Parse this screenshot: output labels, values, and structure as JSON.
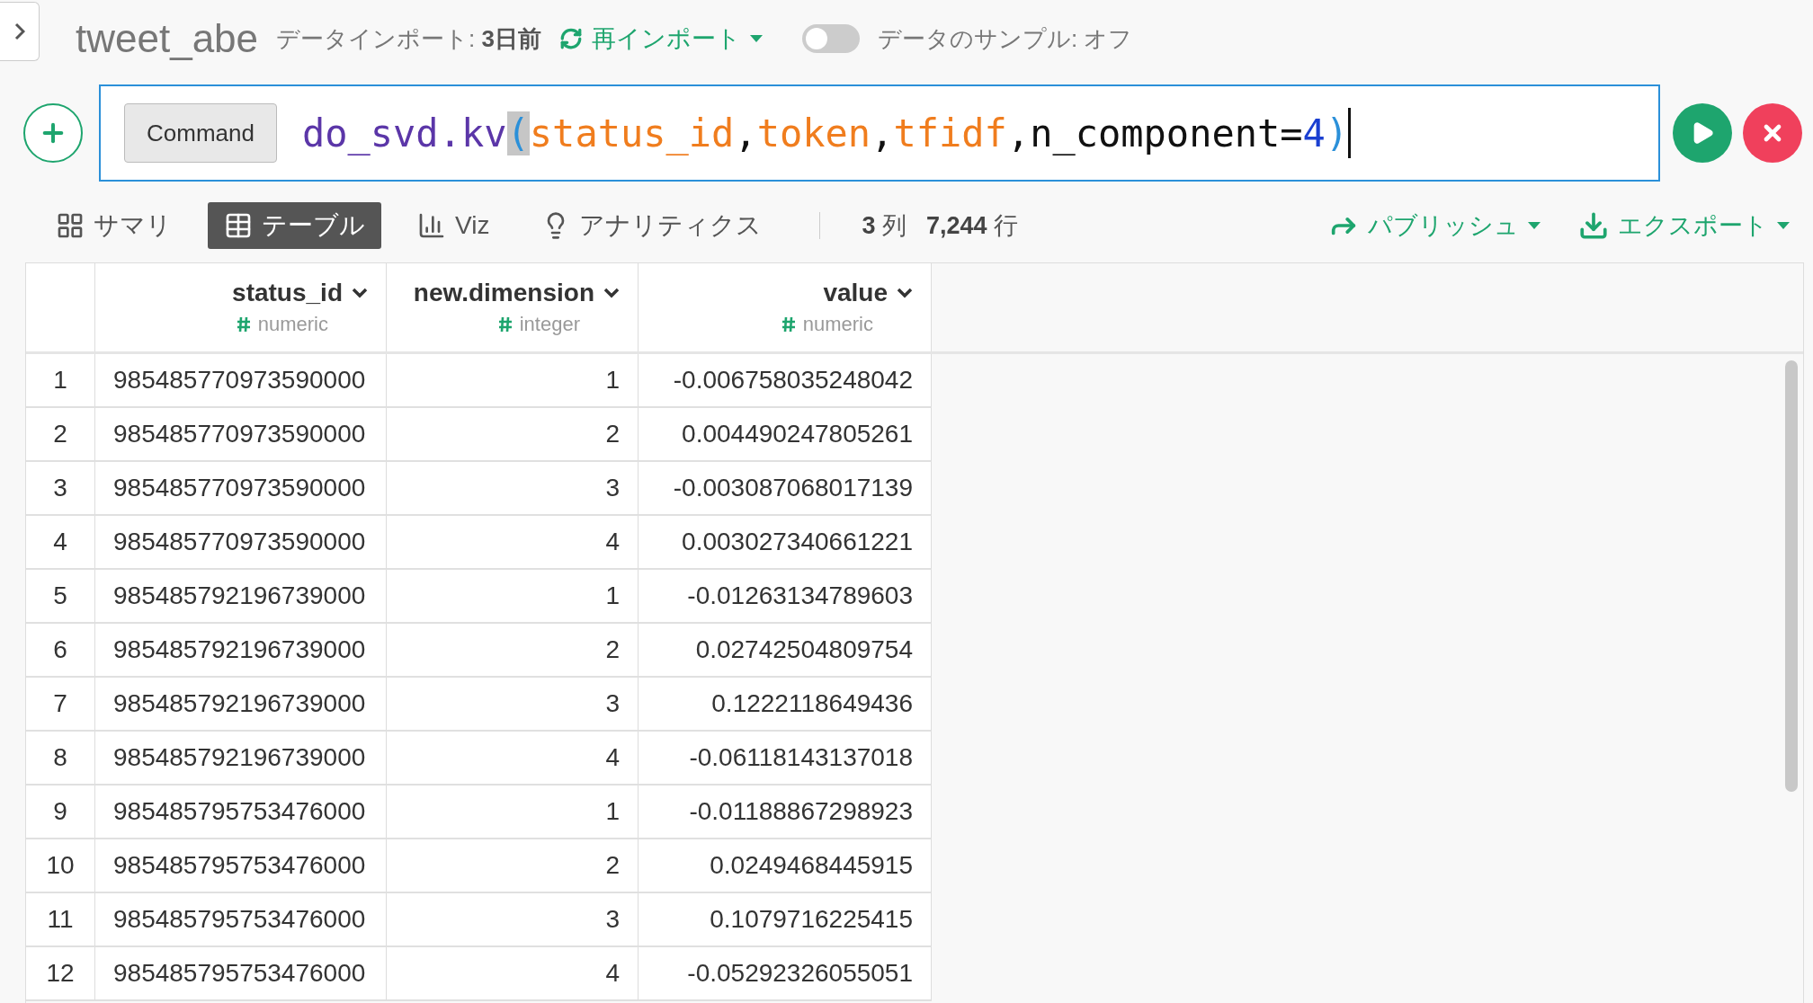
{
  "header": {
    "title": "tweet_abe",
    "import_label": "データインポート: ",
    "import_age": "3日前",
    "reimport": "再インポート",
    "sample_toggle": {
      "on": false,
      "label": "データのサンプル: オフ"
    }
  },
  "command": {
    "button": "Command",
    "tokens": [
      {
        "kind": "function",
        "text": "do_svd.kv",
        "highlighted": false
      },
      {
        "kind": "paren",
        "text": "(",
        "highlighted": true
      },
      {
        "kind": "argument",
        "text": "status_id",
        "highlighted": false
      },
      {
        "kind": "plain",
        "text": ",",
        "highlighted": false
      },
      {
        "kind": "argument",
        "text": "token",
        "highlighted": false
      },
      {
        "kind": "plain",
        "text": ",",
        "highlighted": false
      },
      {
        "kind": "argument",
        "text": "tfidf",
        "highlighted": false
      },
      {
        "kind": "plain",
        "text": ",n_component=",
        "highlighted": false
      },
      {
        "kind": "number",
        "text": "4",
        "highlighted": false
      },
      {
        "kind": "paren",
        "text": ")",
        "highlighted": false
      }
    ]
  },
  "view_tabs": [
    {
      "kind": "summary",
      "label": "サマリ",
      "selected": false
    },
    {
      "kind": "table",
      "label": "テーブル",
      "selected": true
    },
    {
      "kind": "viz",
      "label": "Viz",
      "selected": false
    },
    {
      "kind": "analytics",
      "label": "アナリティクス",
      "selected": false
    }
  ],
  "stats": {
    "columns_count": "3",
    "columns_unit": "列",
    "rows_count": "7,244",
    "rows_unit": "行"
  },
  "actions": [
    {
      "kind": "publish",
      "label": "パブリッシュ"
    },
    {
      "kind": "export",
      "label": "エクスポート"
    }
  ],
  "table": {
    "columns": [
      {
        "name": "status_id",
        "type": "numeric"
      },
      {
        "name": "new.dimension",
        "type": "integer"
      },
      {
        "name": "value",
        "type": "numeric"
      }
    ],
    "rows": [
      {
        "row_number": "1",
        "cells": [
          "985485770973590000",
          "1",
          "-0.006758035248042"
        ]
      },
      {
        "row_number": "2",
        "cells": [
          "985485770973590000",
          "2",
          "0.004490247805261"
        ]
      },
      {
        "row_number": "3",
        "cells": [
          "985485770973590000",
          "3",
          "-0.003087068017139"
        ]
      },
      {
        "row_number": "4",
        "cells": [
          "985485770973590000",
          "4",
          "0.003027340661221"
        ]
      },
      {
        "row_number": "5",
        "cells": [
          "985485792196739000",
          "1",
          "-0.01263134789603"
        ]
      },
      {
        "row_number": "6",
        "cells": [
          "985485792196739000",
          "2",
          "0.02742504809754"
        ]
      },
      {
        "row_number": "7",
        "cells": [
          "985485792196739000",
          "3",
          "0.1222118649436"
        ]
      },
      {
        "row_number": "8",
        "cells": [
          "985485792196739000",
          "4",
          "-0.06118143137018"
        ]
      },
      {
        "row_number": "9",
        "cells": [
          "985485795753476000",
          "1",
          "-0.01188867298923"
        ]
      },
      {
        "row_number": "10",
        "cells": [
          "985485795753476000",
          "2",
          "0.0249468445915"
        ]
      },
      {
        "row_number": "11",
        "cells": [
          "985485795753476000",
          "3",
          "0.1079716225415"
        ]
      },
      {
        "row_number": "12",
        "cells": [
          "985485795753476000",
          "4",
          "-0.05292326055051"
        ]
      }
    ]
  }
}
